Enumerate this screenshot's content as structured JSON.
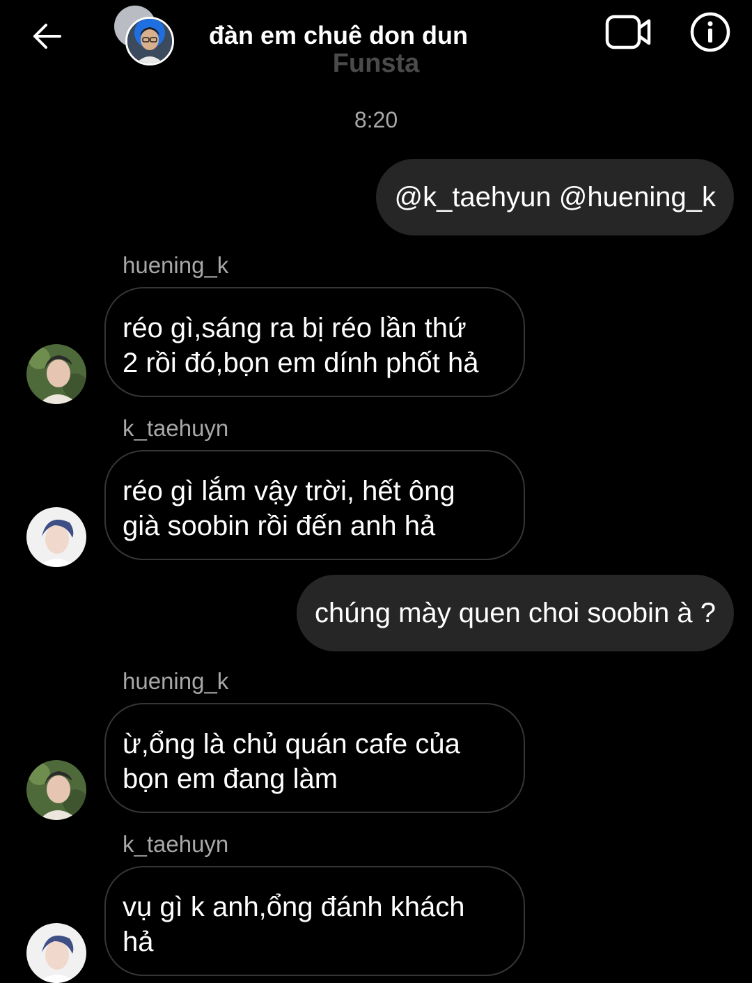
{
  "header": {
    "title": "đàn em chuê don dun",
    "subtitle": "Funsta",
    "back_icon": "arrow-left-icon",
    "video_icon": "video-call-icon",
    "info_icon": "info-icon"
  },
  "timestamp": "8:20",
  "messages": [
    {
      "direction": "out",
      "text": "@k_taehyun @huening_k"
    },
    {
      "direction": "in",
      "sender": "huening_k",
      "line1": "réo gì,sáng ra bị réo lần thứ",
      "line2": "2 rồi đó,bọn em dính phốt hả"
    },
    {
      "direction": "in",
      "sender": "k_taehuyn",
      "line1": "réo gì lắm vậy trời, hết ông",
      "line2": "già  soobin rồi đến anh hả"
    },
    {
      "direction": "out",
      "text": "chúng mày quen choi soobin à ?"
    },
    {
      "direction": "in",
      "sender": "huening_k",
      "line1": "ừ,ổng là chủ quán cafe của",
      "line2": "bọn em đang làm"
    },
    {
      "direction": "in",
      "sender": "k_taehuyn",
      "line1": "vụ gì k anh,ổng đánh khách",
      "line2": "hả"
    }
  ],
  "colors": {
    "background": "#000000",
    "outgoing_bubble": "#262626",
    "incoming_border": "#363636",
    "secondary_text": "#a8a8a8",
    "subtitle": "#4b4b4b"
  }
}
